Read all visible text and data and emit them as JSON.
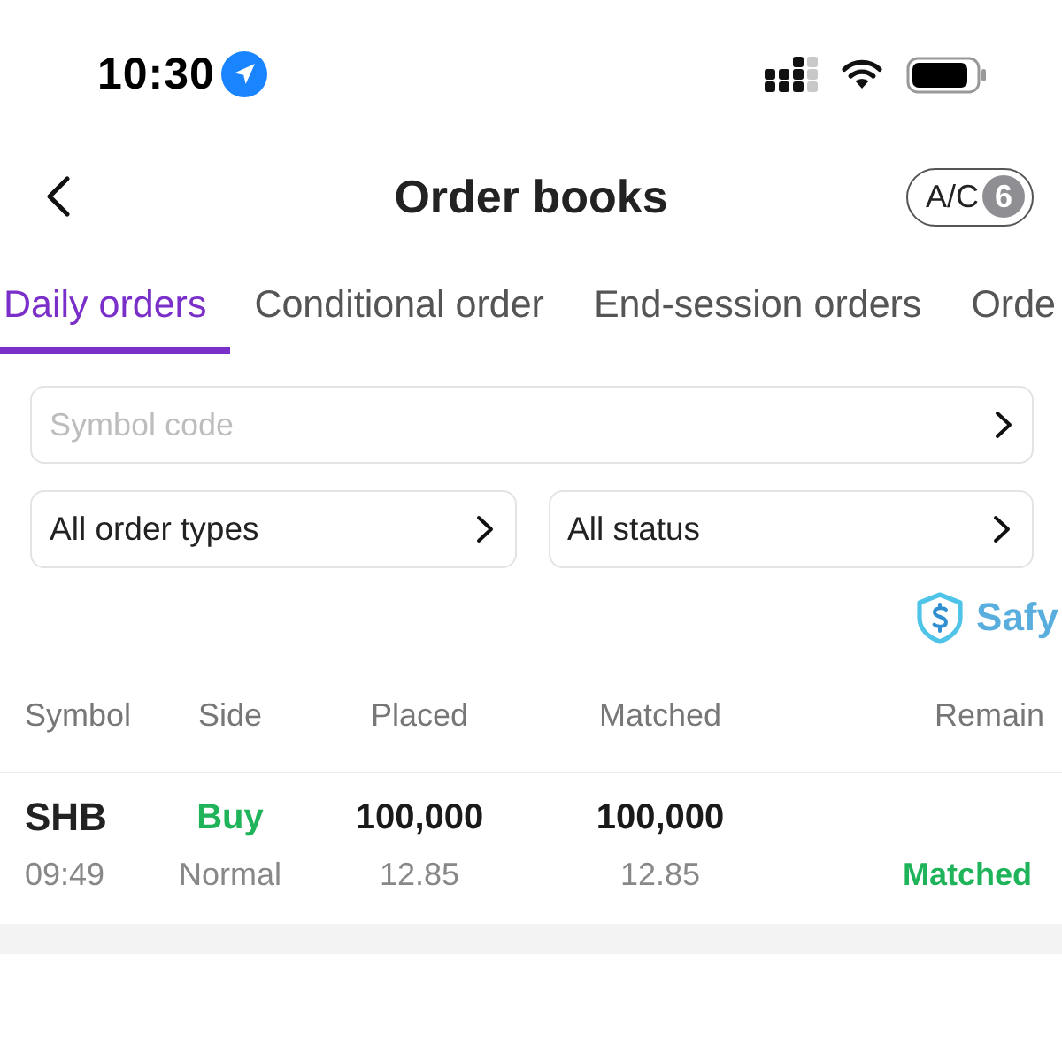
{
  "status_bar": {
    "time": "10:30"
  },
  "header": {
    "title": "Order books",
    "account_button": {
      "label": "A/C",
      "count": "6"
    }
  },
  "tabs": [
    {
      "label": "Daily orders",
      "selected": true
    },
    {
      "label": "Conditional order",
      "selected": false
    },
    {
      "label": "End-session orders",
      "selected": false
    },
    {
      "label": "Orde",
      "selected": false
    }
  ],
  "filters": {
    "symbol_field": {
      "placeholder": "Symbol code"
    },
    "order_type": {
      "value": "All order types"
    },
    "status": {
      "value": "All status"
    }
  },
  "brand": {
    "label": "Safy"
  },
  "table": {
    "columns": [
      "Symbol",
      "Side",
      "Placed",
      "Matched",
      "Remain"
    ],
    "rows": [
      {
        "symbol": "SHB",
        "time": "09:49",
        "side": "Buy",
        "order_type": "Normal",
        "placed_quantity": "100,000",
        "placed_price": "12.85",
        "matched_quantity": "100,000",
        "matched_price": "12.85",
        "status": "Matched"
      }
    ]
  }
}
